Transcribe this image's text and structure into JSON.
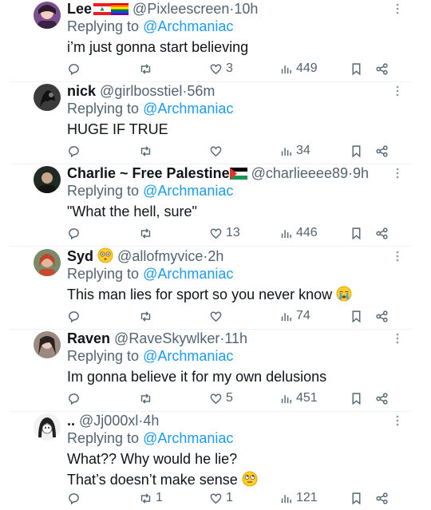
{
  "replies": [
    {
      "name": "Lee",
      "handle": "@Pixleescreen",
      "time": "10h",
      "replying_prefix": "Replying to ",
      "replying_to": "@Archmaniac",
      "text_lines": [
        "i’m just gonna start believing"
      ],
      "reply_count": "",
      "retweet_count": "",
      "like_count": "3",
      "view_count": "449",
      "avatar_color": "#8a5a9c"
    },
    {
      "name": "nick",
      "handle": "@girlbosstiel",
      "time": "56m",
      "replying_prefix": "Replying to ",
      "replying_to": "@Archmaniac",
      "text_lines": [
        "HUGE IF TRUE"
      ],
      "reply_count": "",
      "retweet_count": "",
      "like_count": "",
      "view_count": "34",
      "avatar_color": "#2a2a2a"
    },
    {
      "name": "Charlie ~ Free Palestine",
      "handle": "@charlieeee89",
      "time": "9h",
      "replying_prefix": "Replying to ",
      "replying_to": "@Archmaniac",
      "text_lines": [
        "\"What the hell, sure\""
      ],
      "reply_count": "",
      "retweet_count": "",
      "like_count": "13",
      "view_count": "446",
      "avatar_color": "#1e2a20"
    },
    {
      "name": "Syd",
      "handle": "@allofmyvice",
      "time": "2h",
      "replying_prefix": "Replying to ",
      "replying_to": "@Archmaniac",
      "text_lines": [
        "This man lies for sport so you never know"
      ],
      "reply_count": "",
      "retweet_count": "",
      "like_count": "",
      "view_count": "74",
      "avatar_color": "#b8563a"
    },
    {
      "name": "Raven",
      "handle": "@RaveSkywlker",
      "time": "11h",
      "replying_prefix": "Replying to ",
      "replying_to": "@Archmaniac",
      "text_lines": [
        "Im gonna believe it for my own delusions"
      ],
      "reply_count": "",
      "retweet_count": "",
      "like_count": "5",
      "view_count": "451",
      "avatar_color": "#6a5a55"
    },
    {
      "name": "..",
      "handle": "@Jj000xl",
      "time": "4h",
      "replying_prefix": "Replying to ",
      "replying_to": "@Archmaniac",
      "text_lines": [
        "What?? Why would he lie?",
        "That’s doesn’t make sense"
      ],
      "reply_count": "",
      "retweet_count": "1",
      "like_count": "1",
      "view_count": "121",
      "avatar_color": "#e8e8e8"
    }
  ],
  "separator": "·",
  "colors": {
    "mention": "#1d9bf0",
    "muted": "#536471",
    "text": "#0f1419"
  }
}
